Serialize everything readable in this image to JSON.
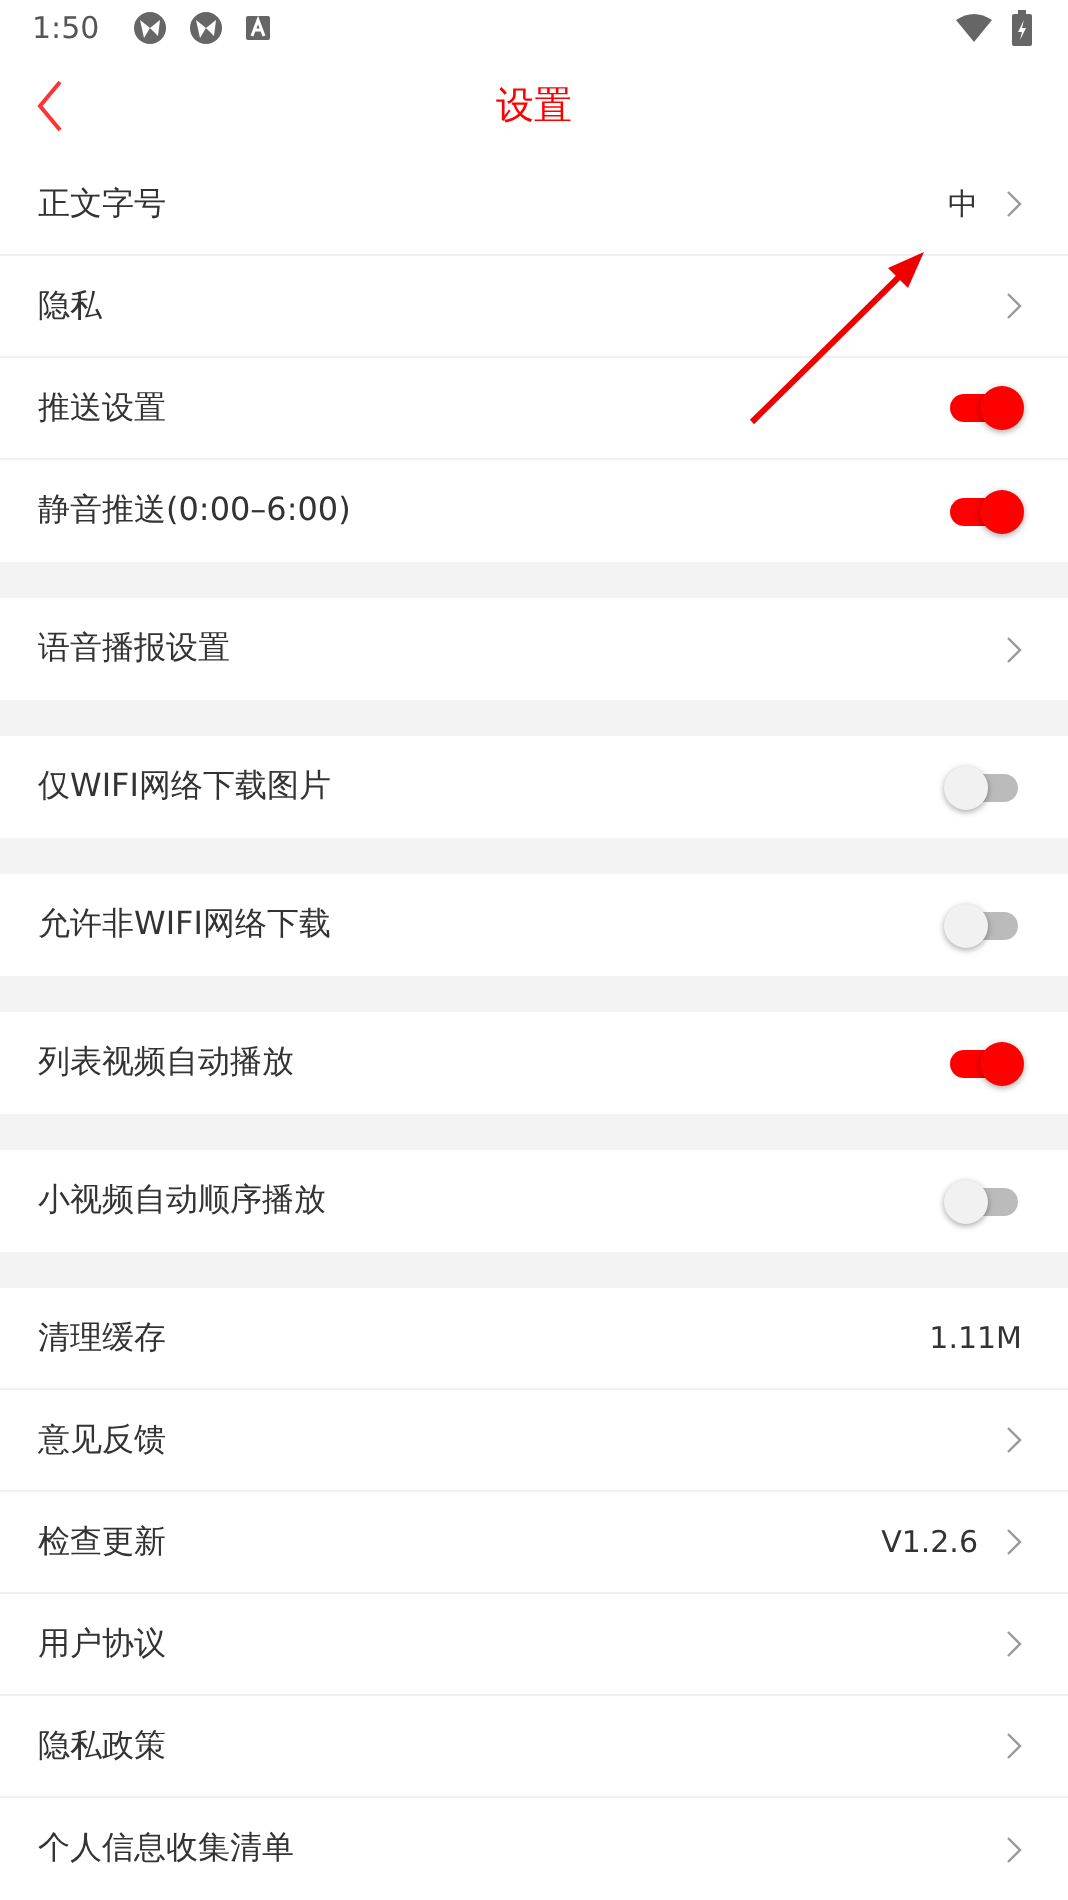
{
  "status_bar": {
    "time": "1:50"
  },
  "header": {
    "title": "设置"
  },
  "groups": [
    {
      "rows": [
        {
          "label": "正文字号",
          "kind": "chevron",
          "value": "中"
        },
        {
          "label": "隐私",
          "kind": "chevron"
        },
        {
          "label": "推送设置",
          "kind": "toggle",
          "on": true
        },
        {
          "label": "静音推送(0:00–6:00)",
          "kind": "toggle",
          "on": true
        }
      ]
    },
    {
      "rows": [
        {
          "label": "语音播报设置",
          "kind": "chevron"
        }
      ]
    },
    {
      "rows": [
        {
          "label": "仅WIFI网络下载图片",
          "kind": "toggle",
          "on": false
        }
      ]
    },
    {
      "rows": [
        {
          "label": "允许非WIFI网络下载",
          "kind": "toggle",
          "on": false
        }
      ]
    },
    {
      "rows": [
        {
          "label": "列表视频自动播放",
          "kind": "toggle",
          "on": true
        }
      ]
    },
    {
      "rows": [
        {
          "label": "小视频自动顺序播放",
          "kind": "toggle",
          "on": false
        }
      ]
    },
    {
      "rows": [
        {
          "label": "清理缓存",
          "kind": "value",
          "value": "1.11M"
        },
        {
          "label": "意见反馈",
          "kind": "chevron"
        },
        {
          "label": "检查更新",
          "kind": "chevron",
          "value": "V1.2.6"
        },
        {
          "label": "用户协议",
          "kind": "chevron"
        },
        {
          "label": "隐私政策",
          "kind": "chevron"
        },
        {
          "label": "个人信息收集清单",
          "kind": "chevron"
        }
      ]
    }
  ]
}
